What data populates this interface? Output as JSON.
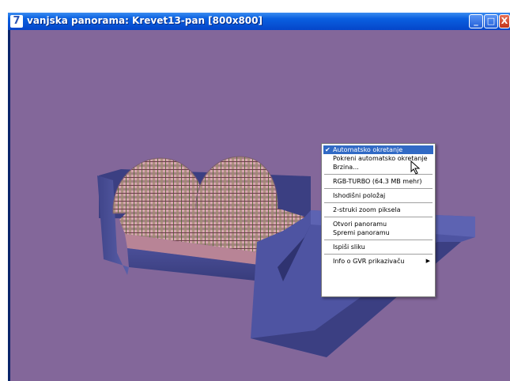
{
  "window": {
    "title": "vanjska panorama: Krevet13-pan [800x800]",
    "app_icon_glyph": "7",
    "controls": {
      "minimize": "_",
      "maximize": "□",
      "close": "X"
    }
  },
  "colors": {
    "background": "#83679a",
    "bed_frame": "#4a4f98",
    "menu_highlight": "#316ac5"
  },
  "context_menu": {
    "groups": [
      [
        {
          "label": "Automatsko okretanje",
          "checked": true,
          "highlighted": true
        },
        {
          "label": "Pokreni automatsko okretanje"
        },
        {
          "label": "Brzina..."
        }
      ],
      [
        {
          "label": "RGB-TURBO (64.3 MB mehr)"
        }
      ],
      [
        {
          "label": "Ishodišni položaj"
        }
      ],
      [
        {
          "label": "2-struki zoom piksela"
        }
      ],
      [
        {
          "label": "Otvori panoramu"
        },
        {
          "label": "Spremi panoramu"
        }
      ],
      [
        {
          "label": "Ispiši sliku"
        }
      ],
      [
        {
          "label": "Info o GVR prikazivaču",
          "submenu": true
        }
      ]
    ],
    "check_glyph": "✔",
    "submenu_glyph": "▶"
  }
}
